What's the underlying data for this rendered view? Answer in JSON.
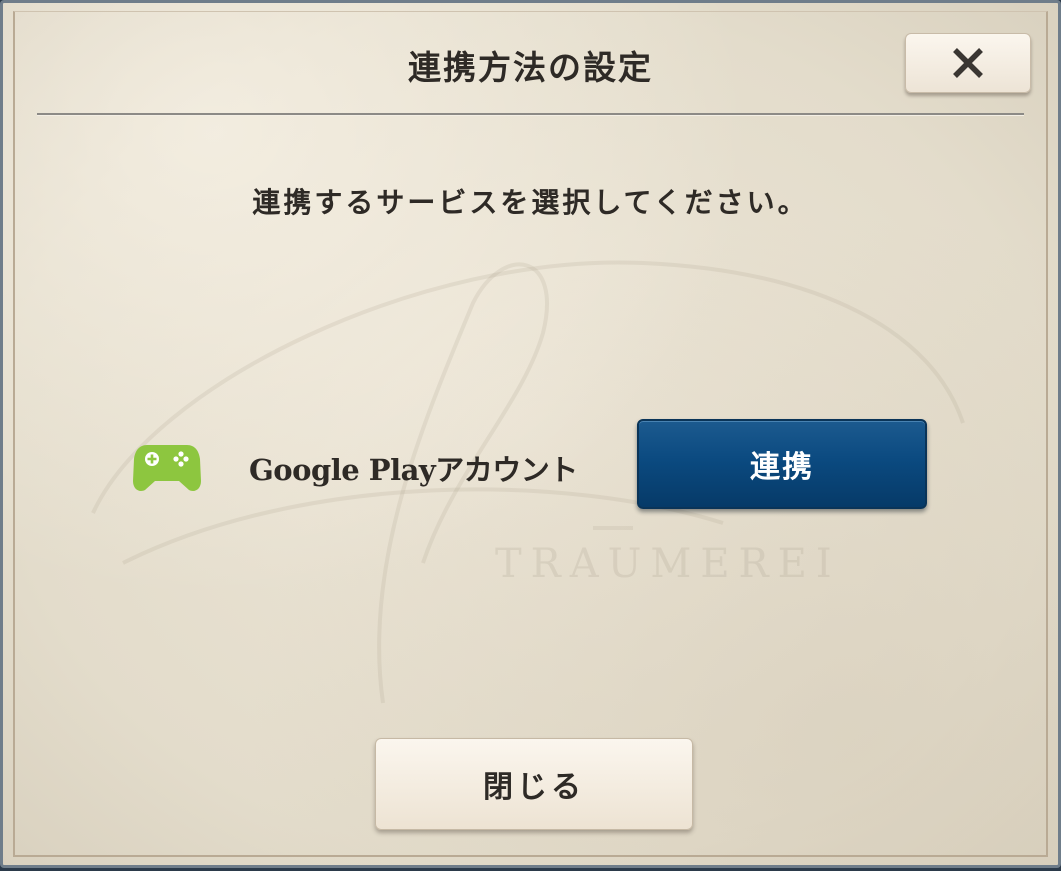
{
  "dialog": {
    "title": "連携方法の設定",
    "close_icon": "close-x-icon",
    "instruction": "連携するサービスを選択してください。",
    "watermark": "TRAUMEREI"
  },
  "services": [
    {
      "icon": "gamepad-icon",
      "icon_color": "#8dc63f",
      "label": "Google Playアカウント",
      "button_label": "連携",
      "button_color": "#0b4a80"
    }
  ],
  "footer": {
    "close_label": "閉じる"
  }
}
